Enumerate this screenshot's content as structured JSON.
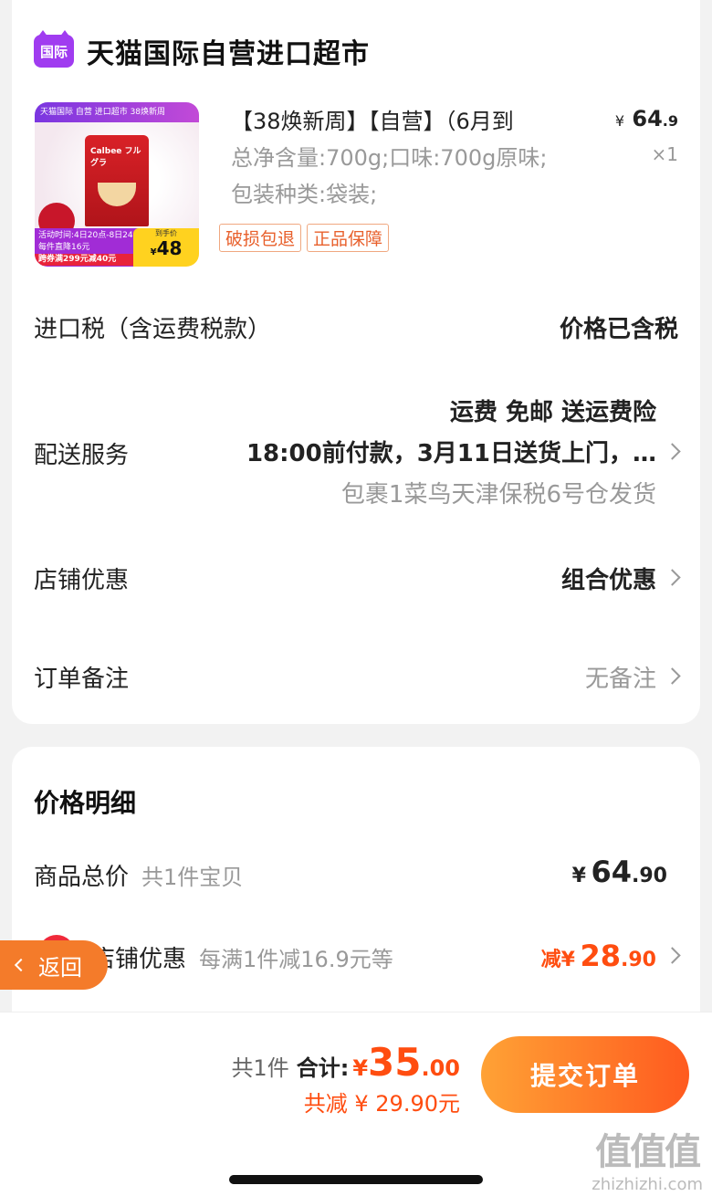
{
  "store": {
    "logo_text": "国际",
    "name": "天猫国际自营进口超市"
  },
  "product": {
    "title": "【38焕新周】【自营】（6月到",
    "spec_line1": "总净含量:700g;口味:700g原味;",
    "spec_line2": "包装种类:袋装;",
    "price_currency": "¥",
    "price_int": "64",
    "price_dec": ".9",
    "quantity": "×1",
    "tags": [
      "破损包退",
      "正品保障"
    ],
    "thumbnail": {
      "top_banner": "天猫国际 自营 进口超市 38焕新周",
      "brand": "Calbee フルグラ",
      "promo_line1": "活动时间:4日20点-8日24点",
      "promo_line2": "每件直降16元",
      "promo_line3": "跨券满299元减40元",
      "price_label": "到手价",
      "price_value": "48",
      "price_currency": "¥"
    }
  },
  "rows": {
    "tax": {
      "label": "进口税（含运费税款）",
      "value": "价格已含税"
    },
    "delivery": {
      "label": "配送服务",
      "line1": "运费 免邮 送运费险",
      "line2": "18:00前付款，3月11日送货上门，…",
      "line3": "包裹1菜鸟天津保税6号仓发货"
    },
    "store_discount": {
      "label": "店铺优惠",
      "value": "组合优惠"
    },
    "order_note": {
      "label": "订单备注",
      "value": "无备注"
    }
  },
  "price_detail": {
    "title": "价格明细",
    "goods_total": {
      "label": "商品总价",
      "sub": "共1件宝贝",
      "currency": "¥",
      "int": "64",
      "dec": ".90"
    },
    "store_discount": {
      "label": "店铺优惠",
      "sub": "每满1件减16.9元等",
      "prefix": "减",
      "currency": "¥",
      "int": "28",
      "dec": ".90"
    }
  },
  "back_button": {
    "label": "返回"
  },
  "footer": {
    "count": "共1件",
    "total_label": "合计:",
    "currency": "¥",
    "total_int": "35",
    "total_dec": ".00",
    "saved": "共减 ¥ 29.90元",
    "submit_label": "提交订单"
  },
  "watermark": {
    "line1": "值值值",
    "line2": "zhizhizhi.com"
  },
  "colors": {
    "accent": "#ff4d10",
    "brand_purple": "#a03cf0",
    "button_from": "#ffa235",
    "button_to": "#ff5a1f"
  }
}
